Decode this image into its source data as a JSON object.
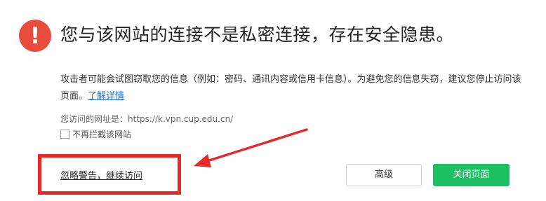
{
  "warning": {
    "icon": "exclamation-icon",
    "icon_glyph": "!",
    "title": "您与该网站的连接不是私密连接，存在安全隐患。",
    "description": "攻击者可能会试图窃取您的信息（例如：密码、通讯内容或信用卡信息）。为避免您的信息失窃，建议您停止访问该页面。",
    "learn_more": "了解详情",
    "url_line": "您访问的网址是：https://k.vpn.cup.edu.cn/",
    "no_block_label": "不再拦截该网站"
  },
  "actions": {
    "ignore_label": "忽略警告，继续访问",
    "advanced_label": "高级",
    "close_label": "关闭页面"
  },
  "colors": {
    "warning_red": "#e84c3d",
    "annotation_red": "#e82929",
    "link_blue": "#1a73e8",
    "primary_green": "#1bc060"
  }
}
